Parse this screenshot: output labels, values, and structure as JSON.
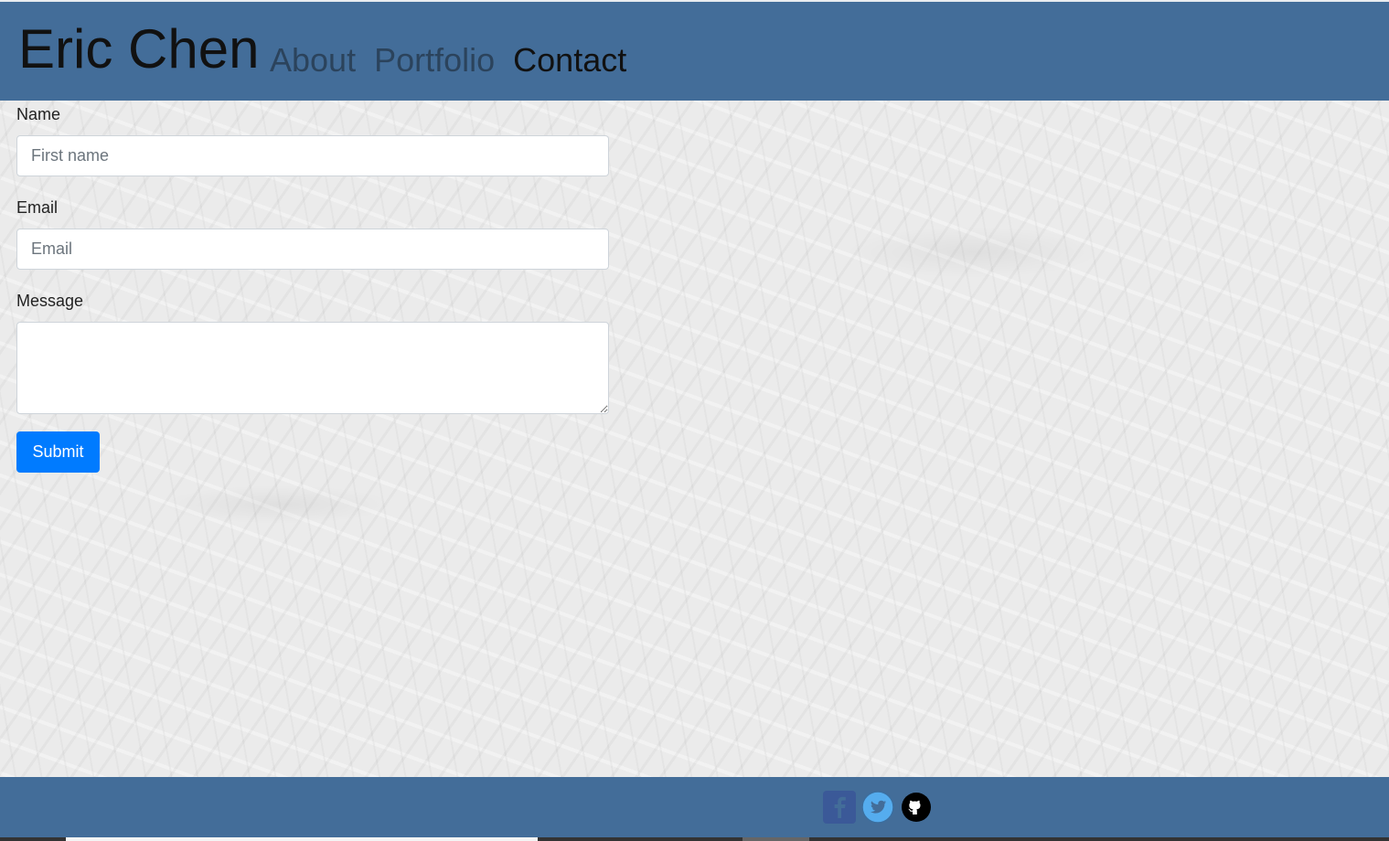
{
  "site": {
    "brand": "Eric Chen"
  },
  "nav": {
    "items": [
      {
        "label": "About",
        "active": false
      },
      {
        "label": "Portfolio",
        "active": false
      },
      {
        "label": "Contact",
        "active": true
      }
    ]
  },
  "form": {
    "name_label": "Name",
    "name_placeholder": "First name",
    "email_label": "Email",
    "email_placeholder": "Email",
    "message_label": "Message",
    "message_value": "",
    "submit_label": "Submit"
  },
  "footer": {
    "social": [
      {
        "name": "facebook-icon"
      },
      {
        "name": "twitter-icon"
      },
      {
        "name": "github-icon"
      }
    ]
  },
  "colors": {
    "header_bg": "#436d99",
    "footer_bg": "#436d99",
    "primary_button": "#007bff",
    "facebook": "#3b5998",
    "twitter": "#55acee",
    "github": "#000000"
  }
}
